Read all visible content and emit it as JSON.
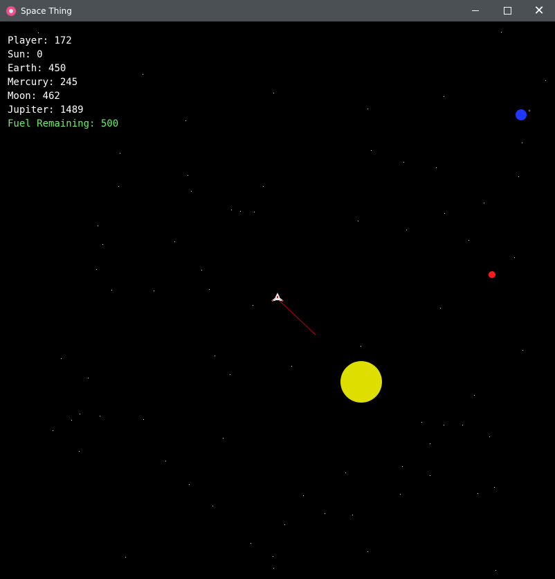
{
  "window": {
    "title": "Space Thing",
    "controls": {
      "minimize": "—",
      "maximize": "☐",
      "close": "✕"
    }
  },
  "hud": [
    {
      "id": "player",
      "label": "Player",
      "value": 172
    },
    {
      "id": "sun",
      "label": "Sun",
      "value": 0
    },
    {
      "id": "earth",
      "label": "Earth",
      "value": 450
    },
    {
      "id": "mercury",
      "label": "Mercury",
      "value": 245
    },
    {
      "id": "moon",
      "label": "Moon",
      "value": 462
    },
    {
      "id": "jupiter",
      "label": "Jupiter",
      "value": 1489
    },
    {
      "id": "fuel",
      "label": "Fuel Remaining",
      "value": 500
    }
  ],
  "colors": {
    "sun": "#dede00",
    "earth": "#1f38ff",
    "mercury": "#ff1a1a",
    "moon": "#555555",
    "velocity_line": "#c40000",
    "fuel_text": "#6bf06b",
    "star": "#ffffff"
  }
}
